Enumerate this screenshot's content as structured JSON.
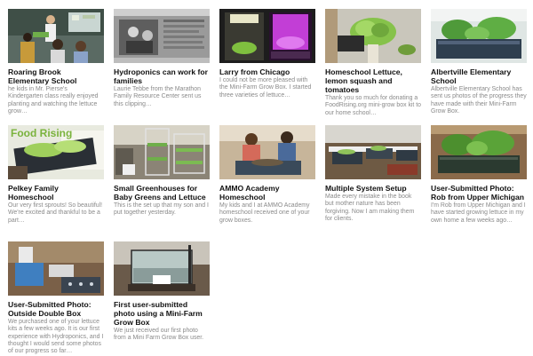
{
  "cards": [
    {
      "title": "Roaring Brook Elementary School",
      "description": "he kids in Mr. Pierse's Kindergarten class really enjoyed planting and watching the lettuce grow…",
      "thumb_icon": "classroom-photo-icon"
    },
    {
      "title": "Hydroponics can work for families",
      "description": "Laurie Tebbe from the Marathon Family Resource Center sent us this clipping…",
      "thumb_icon": "newspaper-clipping-icon"
    },
    {
      "title": "Larry from Chicago",
      "description": "I could not be more pleased with the Mini-Farm Grow Box. I started three varieties of lettuce…",
      "thumb_icon": "grow-light-photo-icon"
    },
    {
      "title": "Homeschool Lettuce, lemon squash and tomatoes",
      "description": "Thank you so much for donating a FoodRising.org mini-grow box kit to our home school…",
      "thumb_icon": "lettuce-in-hand-icon"
    },
    {
      "title": "Albertville Elementary School",
      "description": "Albertville Elementary School has sent us photos of the progress they have made with their Mini-Farm Grow Box.",
      "thumb_icon": "grow-box-photo-icon"
    },
    {
      "title": "Pelkey Family Homeschool",
      "description": "Our very first sprouts! So beautiful! We're excited and thankful to be a part…",
      "thumb_icon": "food-rising-logo-photo-icon",
      "thumb_text": "Food Rising"
    },
    {
      "title": "Small Greenhouses for Baby Greens and Lettuce",
      "description": "This is the set up that my son and I put together yesterday.",
      "thumb_icon": "greenhouse-photo-icon"
    },
    {
      "title": "AMMO Academy Homeschool",
      "description": "My kids and I at AMMO Academy homeschool received one of your grow boxes.",
      "thumb_icon": "kids-planting-photo-icon"
    },
    {
      "title": "Multiple System Setup",
      "description": "Made every mistake in the book but mother nature has been forgiving. Now I am making them for clients.",
      "thumb_icon": "multiple-boxes-photo-icon"
    },
    {
      "title": "User-Submitted Photo: Rob from Upper Michigan",
      "description": "I'm Rob from Upper Michigan and I have started growing lettuce in my own home a few weeks ago…",
      "thumb_icon": "lettuce-box-photo-icon"
    },
    {
      "title": "User-Submitted Photo: Outside Double Box",
      "description": "We purchased one of your lettuce kits a few weeks ago. It is our first experience with Hydroponics, and I thought I would send some photos of our progress so far…",
      "thumb_icon": "outdoor-boxes-photo-icon"
    },
    {
      "title": "First user-submitted photo using a Mini-Farm Grow Box",
      "description": "We just received our first photo from a Mini Farm Grow Box user.",
      "thumb_icon": "aquarium-box-photo-icon"
    }
  ]
}
